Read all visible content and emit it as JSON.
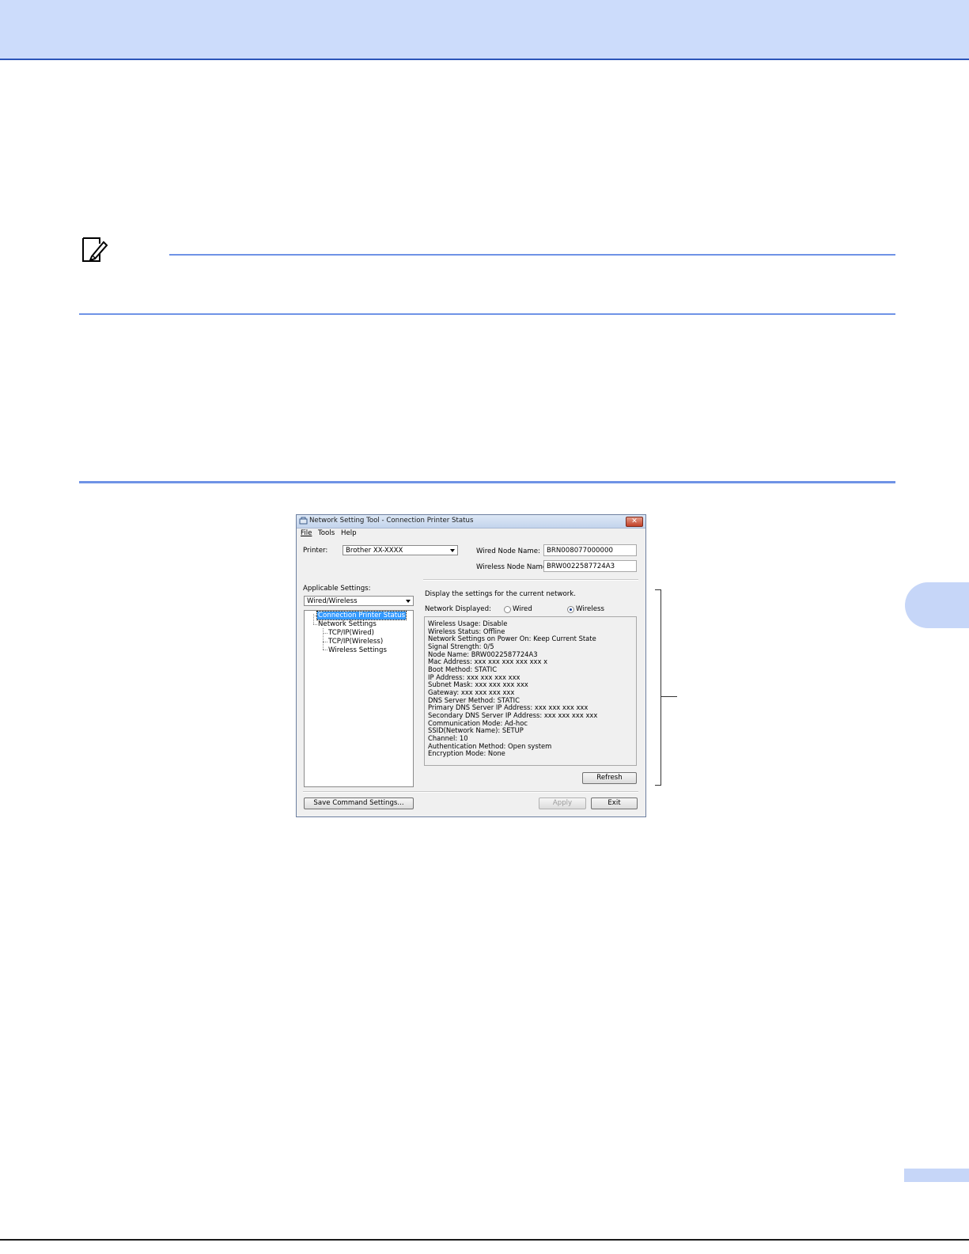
{
  "window": {
    "title": "Network Setting Tool - Connection Printer Status",
    "close_symbol": "✕"
  },
  "menu": [
    "File",
    "Tools",
    "Help"
  ],
  "printer": {
    "label": "Printer:",
    "value": "Brother XX-XXXX"
  },
  "wired_node": {
    "label": "Wired Node Name:",
    "value": "BRN008077000000"
  },
  "wireless_node": {
    "label": "Wireless Node Name:",
    "value": "BRW0022587724A3"
  },
  "applicable": {
    "label": "Applicable Settings:",
    "value": "Wired/Wireless"
  },
  "tree": {
    "items": [
      "Connection Printer Status",
      "Network Settings",
      "TCP/IP(Wired)",
      "TCP/IP(Wireless)",
      "Wireless Settings"
    ]
  },
  "display_text": "Display the settings for the current network.",
  "network_displayed": {
    "label": "Network Displayed:",
    "wired": "Wired",
    "wireless": "Wireless",
    "selected": "Wireless"
  },
  "status_lines": [
    "Wireless Usage: Disable",
    "Wireless Status: Offline",
    "Network Settings on Power On: Keep Current State",
    "Signal Strength: 0/5",
    "Node Name: BRW0022587724A3",
    "Mac Address: xxx xxx xxx xxx xxx x",
    "Boot Method: STATIC",
    "IP Address: xxx xxx xxx xxx",
    "Subnet Mask: xxx xxx xxx xxx",
    "Gateway: xxx xxx xxx xxx",
    "DNS Server Method: STATIC",
    "Primary DNS Server IP Address: xxx xxx xxx xxx",
    "Secondary DNS Server IP Address: xxx xxx xxx xxx",
    "Communication Mode: Ad-hoc",
    "SSID(Network Name): SETUP",
    "Channel: 10",
    "Authentication Method: Open system",
    "Encryption Mode: None"
  ],
  "buttons": {
    "refresh": "Refresh",
    "save_command": "Save Command Settings...",
    "apply": "Apply",
    "exit": "Exit"
  },
  "icons": {
    "note": "pencil-note-icon",
    "app": "network-tool-icon"
  },
  "colors": {
    "header_band": "#ccdcfb",
    "rule": "#6f93e6",
    "selection": "#3399ff"
  }
}
